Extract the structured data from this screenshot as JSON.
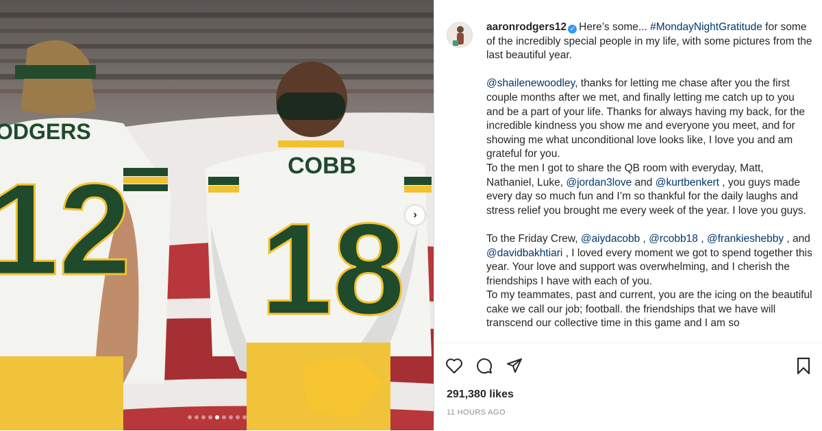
{
  "post": {
    "username": "aaronrodgers12",
    "verified_icon": "verified-badge-icon",
    "caption_blocks": [
      [
        {
          "t": "Here’s some... "
        },
        {
          "t": "#MondayNightGratitude",
          "tag": true
        },
        {
          "t": " for some of the incredibly special people in my life, with some pictures from the last beautiful year."
        }
      ],
      [],
      [
        {
          "t": "@shailenewoodley",
          "tag": true
        },
        {
          "t": ", thanks for letting me chase after you the first couple months after we met, and finally letting me catch up to you and be a part of your life. Thanks for always having my back, for the incredible kindness you show me and everyone you meet, and for showing me what unconditional love looks like, I love you and am grateful for you."
        }
      ],
      [
        {
          "t": "To the men I got to share the QB room with everyday, Matt, Nathaniel, Luke, "
        },
        {
          "t": "@jordan3love",
          "tag": true
        },
        {
          "t": " and "
        },
        {
          "t": "@kurtbenkert",
          "tag": true
        },
        {
          "t": " , you guys made every day so much fun and I’m so thankful for the daily laughs and stress relief you brought me every week of the year. I love you guys."
        }
      ],
      [],
      [
        {
          "t": "To the Friday Crew, "
        },
        {
          "t": "@aiydacobb",
          "tag": true
        },
        {
          "t": " , "
        },
        {
          "t": "@rcobb18",
          "tag": true
        },
        {
          "t": " , "
        },
        {
          "t": "@frankieshebby",
          "tag": true
        },
        {
          "t": " , and "
        },
        {
          "t": "@davidbakhtiari",
          "tag": true
        },
        {
          "t": " , I loved every moment we got to spend together this year. Your love and support was overwhelming, and I cherish the friendships I have with each of you."
        }
      ],
      [
        {
          "t": "To my teammates, past and current, you are the icing on the beautiful cake we call our job; football. the friendships that we have will transcend our collective time in this game and I am so"
        }
      ]
    ],
    "likes": "291,380 likes",
    "timestamp": "11 HOURS AGO"
  },
  "photo": {
    "jersey_left_name": "ODGERS",
    "jersey_left_number": "12",
    "jersey_right_name": "COBB",
    "jersey_right_number": "18",
    "carousel_total": 9,
    "carousel_active_index": 4
  },
  "icons": {
    "like": "heart-icon",
    "comment": "comment-icon",
    "share": "share-icon",
    "save": "bookmark-icon",
    "next": "chevron-right-icon"
  },
  "colors": {
    "link": "#00376b",
    "jersey_green": "#1f4a2c",
    "jersey_gold": "#f2c12e"
  }
}
